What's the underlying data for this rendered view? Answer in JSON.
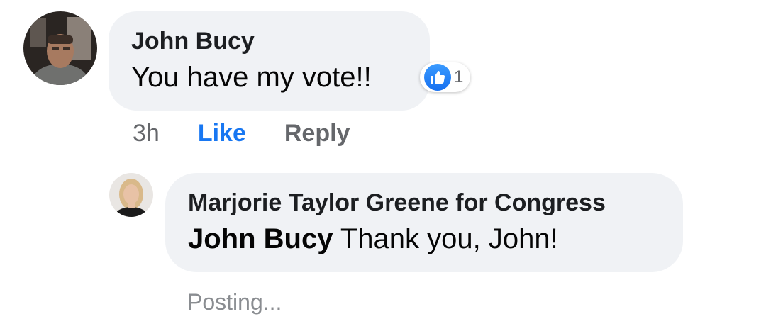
{
  "comment": {
    "author": "John Bucy",
    "text": "You have my vote!!",
    "reaction": {
      "icon": "thumbs-up-icon",
      "count": "1"
    },
    "actions": {
      "time": "3h",
      "like": "Like",
      "reply": "Reply"
    }
  },
  "reply": {
    "author": "Marjorie Taylor Greene for Congress",
    "mention": "John Bucy",
    "text": " Thank you, John!",
    "status": "Posting..."
  },
  "colors": {
    "bubble": "#f0f2f5",
    "like_blue": "#1877f2",
    "secondary_text": "#65676b"
  }
}
